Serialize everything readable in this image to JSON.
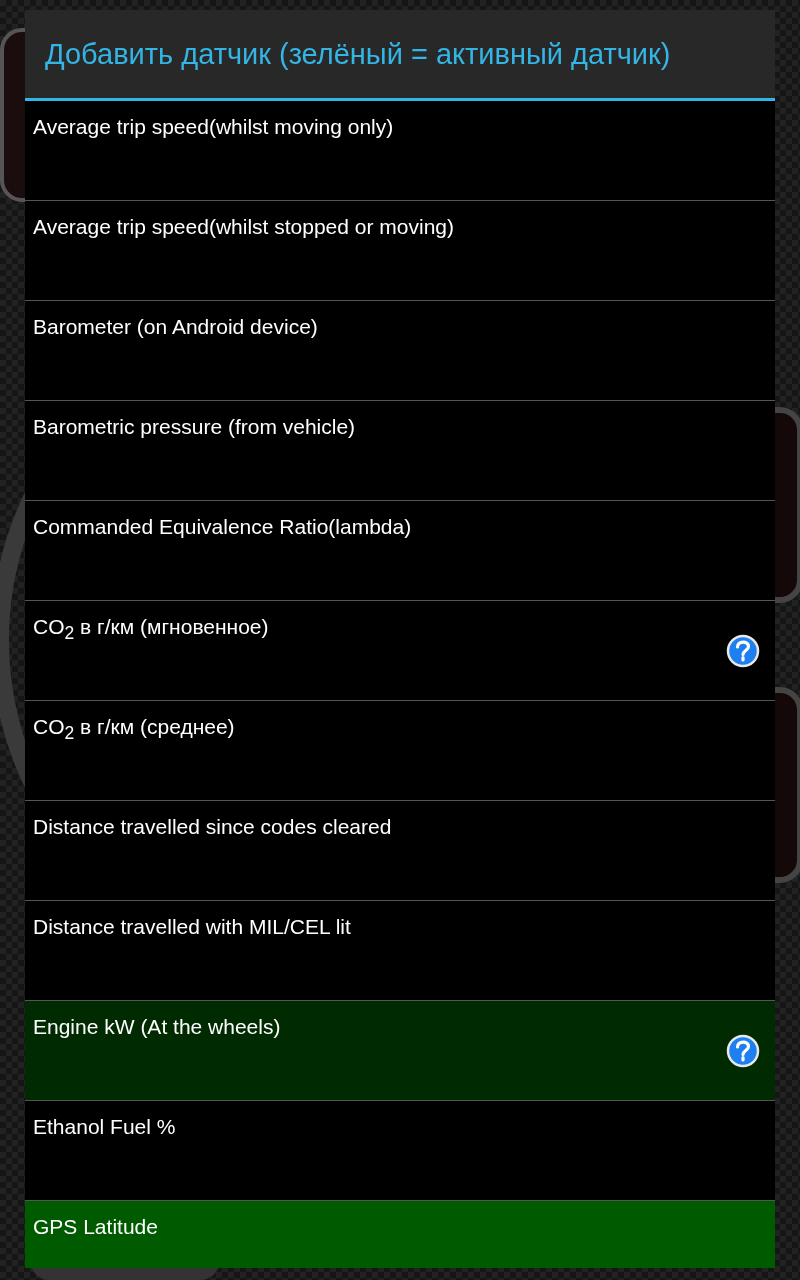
{
  "dialog": {
    "title": "Добавить датчик (зелёный  = активный датчик)",
    "sensors": [
      {
        "label": "Average trip speed(whilst moving only)",
        "active": false,
        "help": false
      },
      {
        "label": "Average trip speed(whilst stopped or moving)",
        "active": false,
        "help": false
      },
      {
        "label": "Barometer (on Android device)",
        "active": false,
        "help": false
      },
      {
        "label": "Barometric pressure (from vehicle)",
        "active": false,
        "help": false
      },
      {
        "label": "Commanded Equivalence Ratio(lambda)",
        "active": false,
        "help": false
      },
      {
        "label": "CO$_{2}$ в г/км (мгновенное)",
        "active": false,
        "help": true
      },
      {
        "label": "CO$_{2}$ в г/км (среднее)",
        "active": false,
        "help": false
      },
      {
        "label": "Distance travelled since codes cleared",
        "active": false,
        "help": false
      },
      {
        "label": "Distance travelled with MIL/CEL lit",
        "active": false,
        "help": false
      },
      {
        "label": "Engine kW (At the wheels)",
        "active": true,
        "color": "#002a00",
        "help": true
      },
      {
        "label": "Ethanol Fuel %",
        "active": false,
        "help": false
      },
      {
        "label": "GPS Latitude",
        "active": true,
        "color": "#005a00",
        "help": false
      }
    ]
  }
}
